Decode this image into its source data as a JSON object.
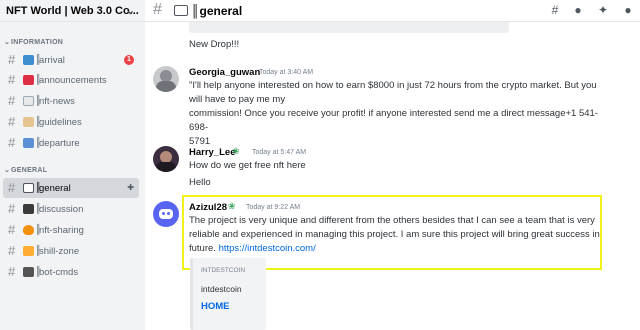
{
  "server": {
    "name": "NFT World | Web 3.0 Co...",
    "chevron_icon": "chevron-down-icon"
  },
  "categories": {
    "information": "INFORMATION",
    "general": "GENERAL"
  },
  "channels": [
    {
      "id": "arrival",
      "label": "arrival",
      "icon": "wave-hand-icon",
      "color": "#3e8ed0",
      "badge": "1"
    },
    {
      "id": "announcements",
      "label": "announcements",
      "icon": "megaphone-icon",
      "color": "#dd2e44"
    },
    {
      "id": "nft-news",
      "label": "nft-news",
      "icon": "newspaper-icon",
      "color": "#99aab5"
    },
    {
      "id": "guidelines",
      "label": "guidelines",
      "icon": "scroll-icon",
      "color": "#c9a26b"
    },
    {
      "id": "departure",
      "label": "departure",
      "icon": "wave-icon",
      "color": "#5b8fd6"
    },
    {
      "id": "general",
      "label": "general",
      "icon": "speech-bubble-icon",
      "color": "#4f5660",
      "active": true
    },
    {
      "id": "discussion",
      "label": "discussion",
      "icon": "speech-icon",
      "color": "#3b3b3b"
    },
    {
      "id": "nft-sharing",
      "label": "nft-sharing",
      "icon": "fire-icon",
      "color": "#f4900c"
    },
    {
      "id": "shill-zone",
      "label": "shill-zone",
      "icon": "lightning-icon",
      "color": "#ffac33"
    },
    {
      "id": "bot-cmds",
      "label": "bot-cmds",
      "icon": "robot-icon",
      "color": "#555555"
    }
  ],
  "topbar": {
    "title": "║general"
  },
  "messages": {
    "new_drop": "New Drop!!!",
    "georgia": {
      "author": "Georgia_guwan",
      "time": "Today at 3:40 AM",
      "line1": "\"I'll help anyone interested on how to earn $8000 in just 72 hours  from the crypto market. But you",
      "line2": "will have to pay me my",
      "line3": "commission! Once you receive your profit! if anyone interested send me a direct message+1 541-698-",
      "line4": "5791"
    },
    "harry": {
      "author": "Harry_Lee",
      "time": "Today at 5:47 AM",
      "line1": "How do we get free nft here",
      "line2": "Hello"
    },
    "azizul": {
      "author": "Azizul28",
      "time": "Today at 9:22 AM",
      "line1": "The project is very unique and different from the others besides that I can see a team that is very",
      "line2": "reliable and experienced in managing this project. I am sure this project will bring great success in",
      "line3": "future.",
      "link": "https://intdestcoin.com/"
    }
  },
  "embed": {
    "site": "INTDESTCOIN",
    "title": "intdestcoin",
    "home": "HOME"
  }
}
